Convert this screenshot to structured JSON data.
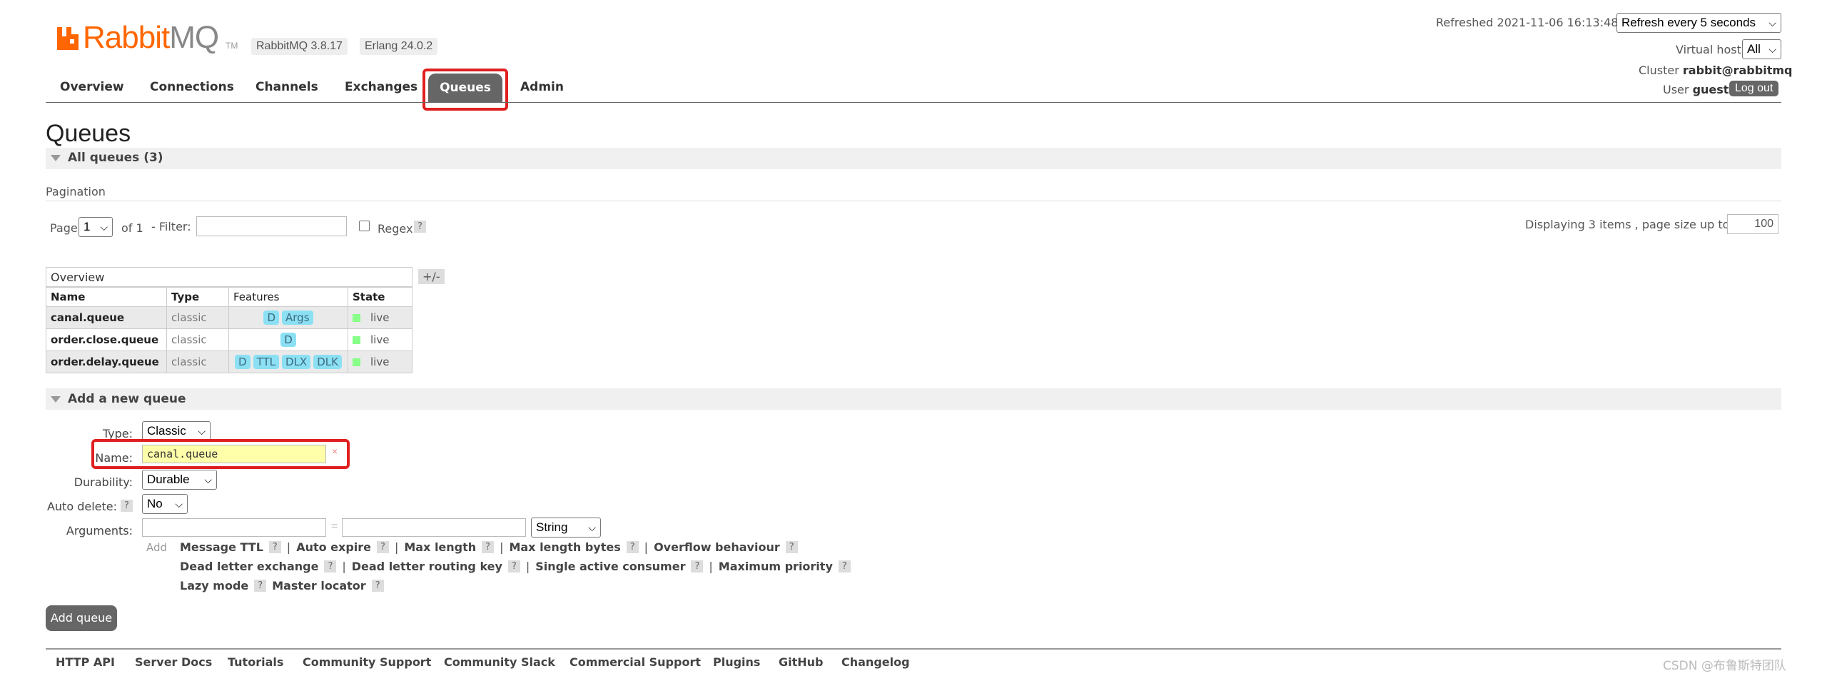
{
  "brand": {
    "name_a": "Rabbit",
    "name_b": "MQ",
    "tm": "TM",
    "version": "RabbitMQ 3.8.17",
    "erlang": "Erlang 24.0.2"
  },
  "nav": {
    "overview": "Overview",
    "connections": "Connections",
    "channels": "Channels",
    "exchanges": "Exchanges",
    "queues": "Queues",
    "admin": "Admin"
  },
  "status": {
    "refreshed": "Refreshed 2021-11-06 16:13:48",
    "refresh_option": "Refresh every 5 seconds",
    "vhost_label": "Virtual host",
    "vhost_value": "All",
    "cluster_label": "Cluster",
    "cluster_value": "rabbit@rabbitmq",
    "user_label": "User",
    "user_value": "guest",
    "logout": "Log out"
  },
  "page": {
    "title": "Queues",
    "all_queues": "All queues (3)"
  },
  "pagination": {
    "heading": "Pagination",
    "page_label": "Page",
    "page_value": "1",
    "of_label": "of 1",
    "filter_label": "- Filter:",
    "regex_label": "Regex",
    "help": "?",
    "displaying": "Displaying 3 items , page size up to:",
    "page_size": "100"
  },
  "table": {
    "group_header": "Overview",
    "toggle": "+/-",
    "columns": [
      "Name",
      "Type",
      "Features",
      "State"
    ],
    "rows": [
      {
        "name": "canal.queue",
        "type": "classic",
        "features": [
          "D",
          "Args"
        ],
        "state": "live"
      },
      {
        "name": "order.close.queue",
        "type": "classic",
        "features": [
          "D"
        ],
        "state": "live"
      },
      {
        "name": "order.delay.queue",
        "type": "classic",
        "features": [
          "D",
          "TTL",
          "DLX",
          "DLK"
        ],
        "state": "live"
      }
    ]
  },
  "add_queue": {
    "heading": "Add a new queue",
    "type_label": "Type:",
    "type_value": "Classic",
    "name_label": "Name:",
    "name_value": "canal.queue",
    "clear": "×",
    "durability_label": "Durability:",
    "durability_value": "Durable",
    "auto_delete_label": "Auto delete:",
    "auto_delete_value": "No",
    "arguments_label": "Arguments:",
    "equals": "=",
    "arg_type": "String",
    "add_label": "Add",
    "arg_row1": [
      "Message TTL",
      "Auto expire",
      "Max length",
      "Max length bytes",
      "Overflow behaviour"
    ],
    "arg_row2": [
      "Dead letter exchange",
      "Dead letter routing key",
      "Single active consumer",
      "Maximum priority"
    ],
    "arg_row3": [
      "Lazy mode",
      "Master locator"
    ],
    "separator": "|",
    "submit": "Add queue"
  },
  "footer": [
    "HTTP API",
    "Server Docs",
    "Tutorials",
    "Community Support",
    "Community Slack",
    "Commercial Support",
    "Plugins",
    "GitHub",
    "Changelog"
  ],
  "watermark": "CSDN @布鲁斯特团队",
  "colors": {
    "brand_orange": "#ff6600",
    "nav_active": "#666666",
    "highlight": "#e02020",
    "tag_blue": "#8ce0f3",
    "live_green": "#88ff88"
  }
}
